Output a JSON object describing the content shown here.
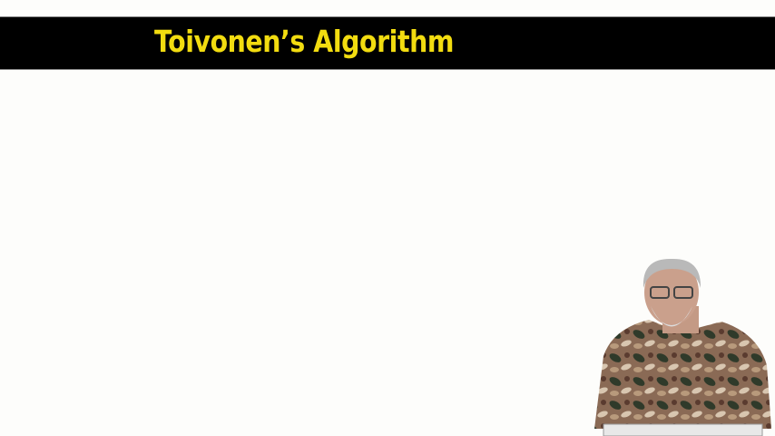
{
  "slide": {
    "title": "Toivonen’s Algorithm",
    "title_color": "#f2dc10",
    "title_bar_color": "#000000"
  }
}
